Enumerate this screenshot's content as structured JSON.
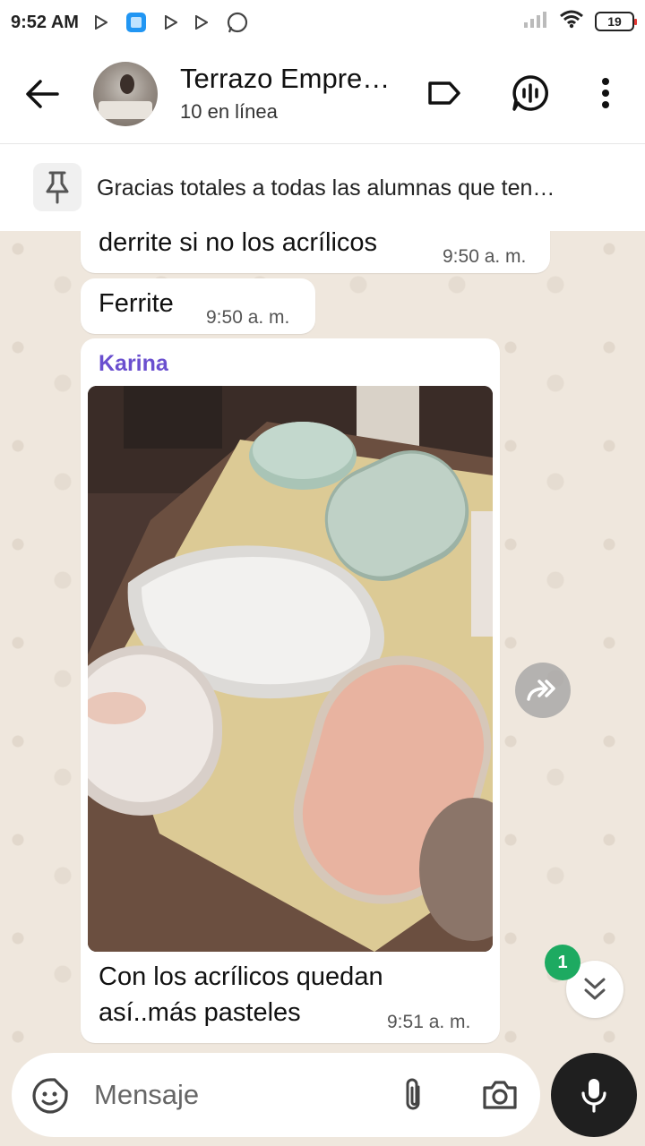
{
  "status_bar": {
    "time": "9:52 AM",
    "battery": "19"
  },
  "header": {
    "title": "Terrazo Empre…",
    "subtitle": "10 en línea"
  },
  "pinned": {
    "text": "Gracias totales a todas las alumnas que ten…"
  },
  "messages": [
    {
      "text": "derrite si no los acrílicos",
      "time": "9:50 a. m."
    },
    {
      "text": "Ferrite",
      "time": "9:50 a. m."
    },
    {
      "sender": "Karina",
      "caption_line1": "Con los acrílicos quedan",
      "caption_line2": "así..más pasteles",
      "time": "9:51 a. m."
    }
  ],
  "scroll": {
    "unread_count": "1"
  },
  "composer": {
    "placeholder": "Mensaje"
  },
  "colors": {
    "accent_green": "#1daa61",
    "sender_purple": "#6a4fcf",
    "chat_background": "#efe7dd"
  },
  "icons": {
    "back": "arrow-left-icon",
    "label": "label-tag-icon",
    "voice_chat": "voice-chat-icon",
    "menu": "more-vertical-icon",
    "pin": "pin-icon",
    "forward": "forward-icon",
    "scroll_down": "double-chevron-down-icon",
    "sticker": "sticker-icon",
    "attach": "paperclip-icon",
    "camera": "camera-icon",
    "mic": "microphone-icon"
  }
}
